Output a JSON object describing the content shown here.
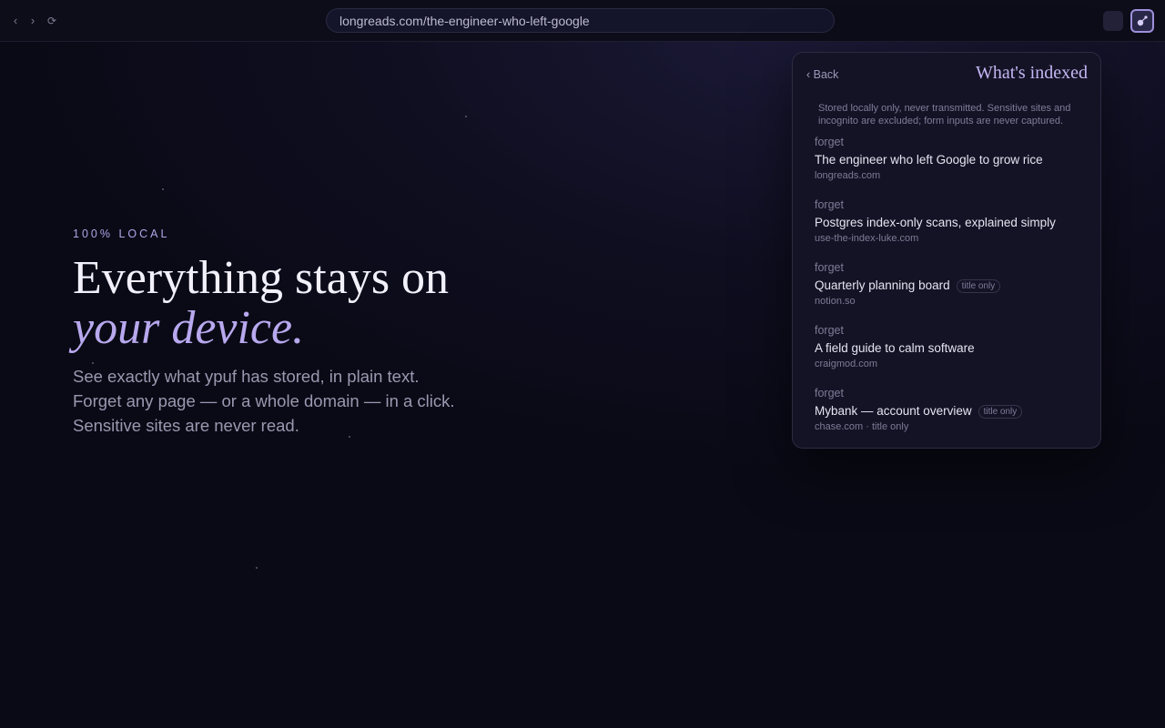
{
  "browser": {
    "back_icon": "‹",
    "forward_icon": "›",
    "reload_icon": "⟳",
    "url": "longreads.com/the-engineer-who-left-google"
  },
  "hero": {
    "eyebrow": "100% LOCAL",
    "headline_line1": "Everything stays on",
    "headline_line2": "your device.",
    "subtext": "See exactly what ypuf has stored, in plain text. Forget any page — or a whole domain — in a click. Sensitive sites are never read."
  },
  "panel": {
    "back_label": "‹ Back",
    "title": "What's indexed",
    "note": "Stored locally only, never transmitted. Sensitive sites and incognito are excluded; form inputs are never captured.",
    "entries": [
      {
        "forget": "forget",
        "title": "The engineer who left Google to grow rice",
        "badge": "",
        "domain": "longreads.com"
      },
      {
        "forget": "forget",
        "title": "Postgres index-only scans, explained simply",
        "badge": "",
        "domain": "use-the-index-luke.com"
      },
      {
        "forget": "forget",
        "title": "Quarterly planning board",
        "badge": "title only",
        "domain": "notion.so"
      },
      {
        "forget": "forget",
        "title": "A field guide to calm software",
        "badge": "",
        "domain": "craigmod.com"
      },
      {
        "forget": "forget",
        "title": "Mybank — account overview",
        "badge": "title only",
        "domain": "chase.com · title only"
      }
    ]
  },
  "colors": {
    "accent": "#b8a8ee",
    "background": "#0b0b17",
    "panel": "#141326"
  }
}
